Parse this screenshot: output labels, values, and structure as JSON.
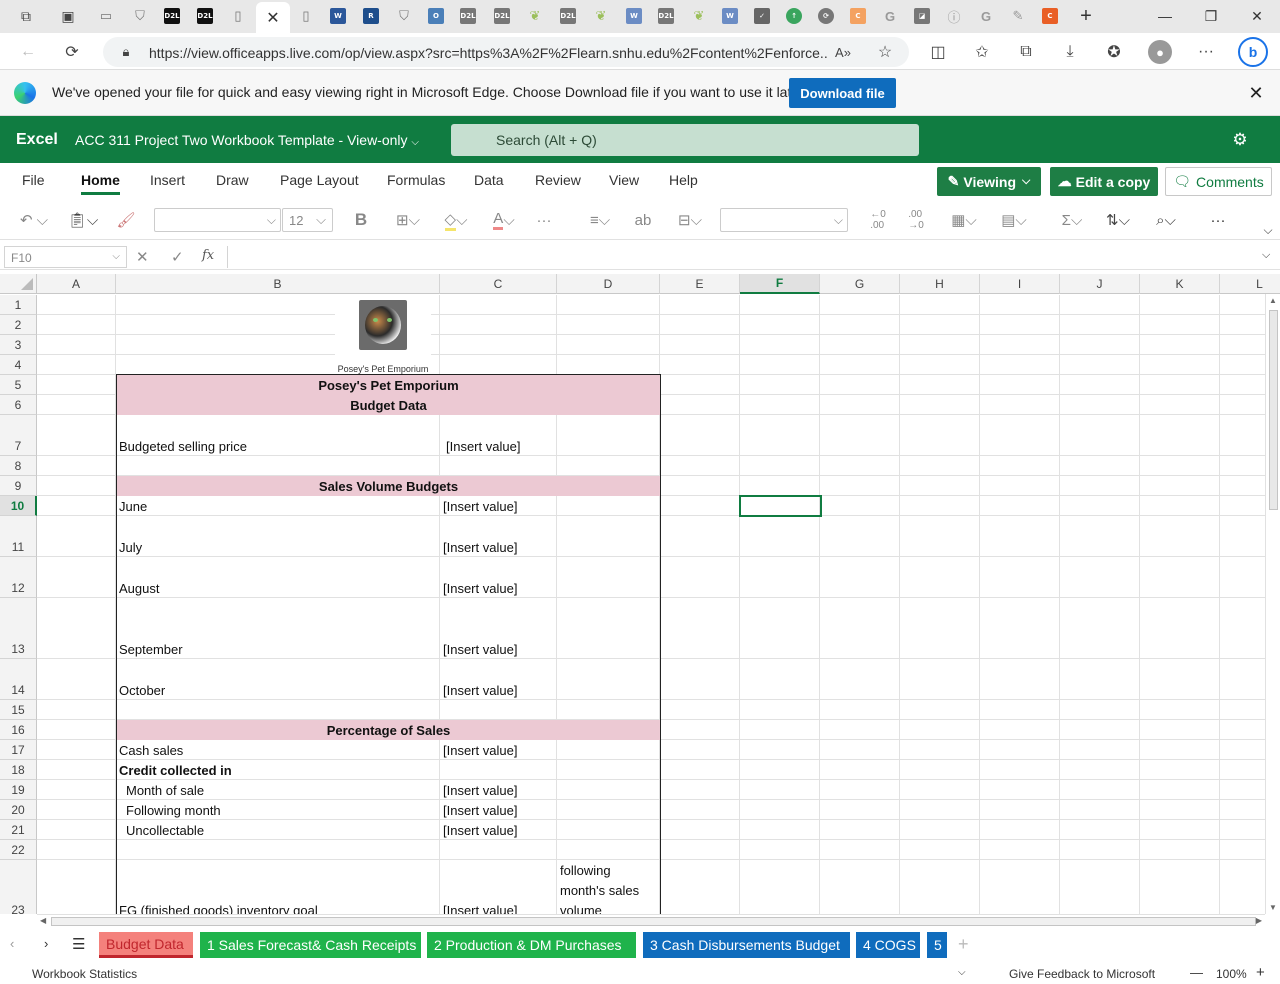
{
  "browser": {
    "url": "https://view.officeapps.live.com/op/view.aspx?src=https%3A%2F%2Flearn.snhu.edu%2Fcontent%2Fenforce...",
    "tabs": [
      "D2L",
      "D2L",
      "D2L",
      "D2L",
      "D2L",
      "D2L",
      "D2L"
    ]
  },
  "infobar": {
    "message": "We've opened your file for quick and easy viewing right in Microsoft Edge. Choose Download file if you want to use it later.",
    "download_label": "Download file"
  },
  "excel": {
    "app_name": "Excel",
    "doc_title": "ACC 311 Project Two Workbook Template  -  View-only",
    "search_placeholder": "Search (Alt + Q)",
    "menu": [
      "File",
      "Home",
      "Insert",
      "Draw",
      "Page Layout",
      "Formulas",
      "Data",
      "Review",
      "View",
      "Help"
    ],
    "viewing_label": "Viewing",
    "edit_copy_label": "Edit a copy",
    "comments_label": "Comments",
    "font_size": "12",
    "name_box": "F10",
    "fx_label": "fx"
  },
  "grid": {
    "columns": [
      "A",
      "B",
      "C",
      "D",
      "E",
      "F",
      "G",
      "H",
      "I",
      "J",
      "K",
      "L"
    ],
    "rows": [
      "1",
      "2",
      "3",
      "4",
      "5",
      "6",
      "7",
      "8",
      "9",
      "10",
      "11",
      "12",
      "13",
      "14",
      "15",
      "16",
      "17",
      "18",
      "19",
      "20",
      "21",
      "22",
      "23"
    ],
    "logo_caption": "Posey's Pet Emporium",
    "title1": "Posey's Pet Emporium",
    "title2": "Budget Data",
    "selling_price_label": "Budgeted selling price",
    "insert_value": "[Insert value]",
    "sales_volume_header": "Sales Volume Budgets",
    "months": [
      "June",
      "July",
      "August",
      "September",
      "October"
    ],
    "pct_header": "Percentage of Sales",
    "cash_sales": "Cash sales",
    "credit_collected": "Credit collected in",
    "month_of_sale": "Month of sale",
    "following_month": "Following month",
    "uncollectable": "Uncollectable",
    "fg_label": "FG (finished goods) inventory goal",
    "fg_note": [
      "following",
      "month's sales",
      "volume"
    ]
  },
  "sheets": [
    {
      "label": "Budget Data",
      "color": "#f4817c",
      "text": "#c0262d"
    },
    {
      "label": "1 Sales Forecast& Cash Receipts",
      "color": "#1fb34b",
      "text": "#ffffff"
    },
    {
      "label": "2 Production & DM Purchases",
      "color": "#1fb34b",
      "text": "#ffffff"
    },
    {
      "label": "3 Cash Disbursements Budget",
      "color": "#0f6cbd",
      "text": "#ffffff"
    },
    {
      "label": "4 COGS",
      "color": "#0f6cbd",
      "text": "#ffffff"
    },
    {
      "label": "5",
      "color": "#0f6cbd",
      "text": "#ffffff"
    }
  ],
  "status": {
    "stats": "Workbook Statistics",
    "feedback": "Give Feedback to Microsoft",
    "zoom": "100%"
  }
}
